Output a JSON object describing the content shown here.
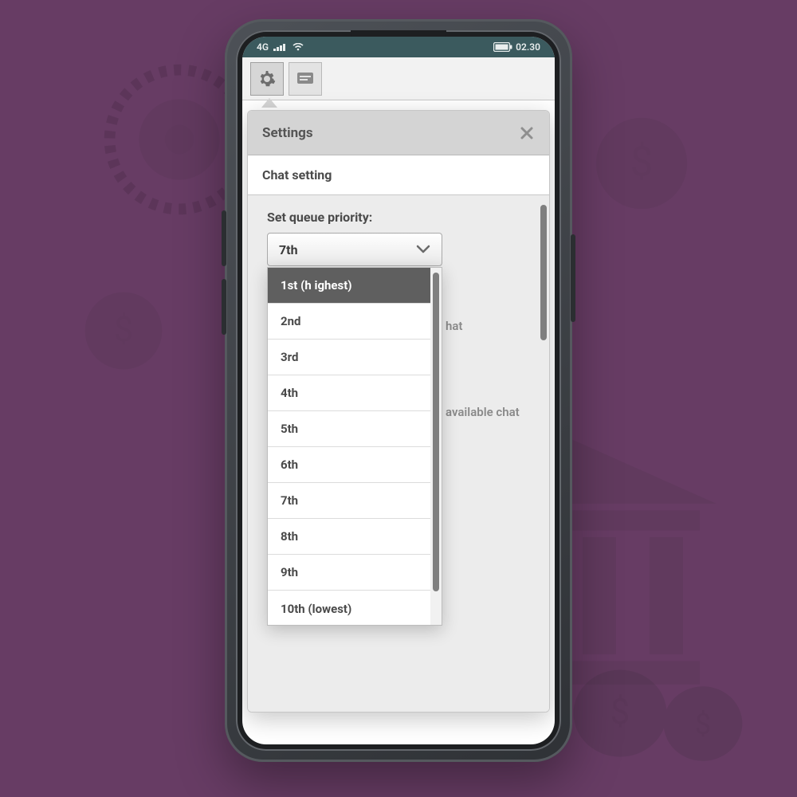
{
  "statusbar": {
    "network": "4G",
    "time": "02.30"
  },
  "toolbar": {
    "icons": {
      "settings": "gear-icon",
      "chat": "chat-icon"
    }
  },
  "panel": {
    "title": "Settings",
    "subtitle": "Chat setting",
    "queue_label": "Set queue priority:",
    "selected_value": "7th",
    "options": [
      "1st (h ighest)",
      "2nd",
      "3rd",
      "4th",
      "5th",
      "6th",
      "7th",
      "8th",
      "9th",
      "10th (lowest)"
    ],
    "highlighted_index": 0,
    "bg_text_1": "hat",
    "bg_text_2": "available chat"
  }
}
